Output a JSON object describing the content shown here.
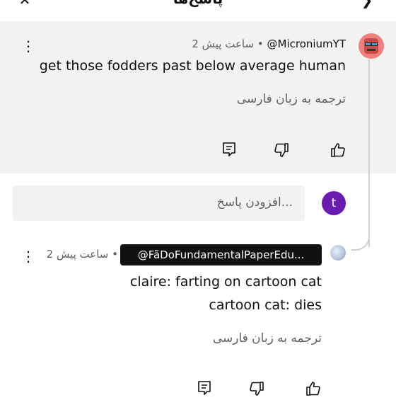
{
  "header": {
    "title": "پاسخ‌ها"
  },
  "main_comment": {
    "handle": "@MicroniumYT",
    "time": "2 ساعت پیش",
    "separator": "•",
    "text": "get those fodders past below average human",
    "translate_label": "ترجمه به زبان فارسی"
  },
  "reply_input": {
    "placeholder": "افزودن پاسخ...",
    "avatar_letter": "t"
  },
  "reply_comment": {
    "handle": "@FãDoFundamentalPaperEdu...",
    "time": "2 ساعت پیش",
    "separator": "•",
    "text_line1": "claire: farting on cartoon cat",
    "text_line2": "cartoon cat: dies",
    "translate_label": "ترجمه به زبان فارسی"
  },
  "colors": {
    "avatar_t": "#6a1bb0",
    "main_bg": "#f2f2f2",
    "badge_bg": "#111111",
    "avatar_main": "#f08080"
  },
  "icons": [
    "close-icon",
    "back-icon",
    "more-vert-icon",
    "like-icon",
    "dislike-icon",
    "reply-icon"
  ]
}
